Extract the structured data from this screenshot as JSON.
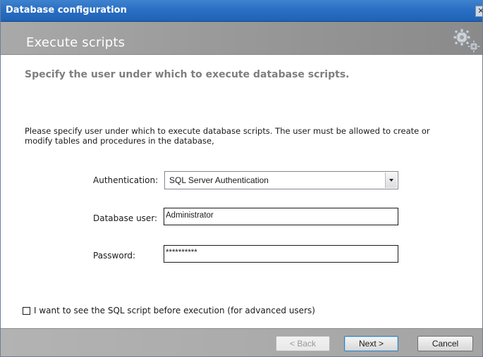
{
  "window": {
    "title": "Database configuration",
    "close_glyph": "✕"
  },
  "header": {
    "title": "Execute scripts",
    "icon": "gears-icon"
  },
  "main": {
    "heading": "Specify the user under which to execute database scripts.",
    "description_line1": "Please specify user under which to execute database scripts. The user must be allowed to create or",
    "description_line2": "modify tables and procedures in the database,"
  },
  "form": {
    "authentication_label": "Authentication:",
    "authentication_value": "SQL Server Authentication",
    "database_user_label": "Database user:",
    "database_user_value": "Administrator",
    "password_label": "Password:",
    "password_value": "**********"
  },
  "options": {
    "show_script_label": "I want to see the SQL script before execution (for advanced users)",
    "show_script_checked": false
  },
  "footer": {
    "back_label": "< Back",
    "next_label": "Next >",
    "cancel_label": "Cancel"
  },
  "colors": {
    "titlebar": "#2a6fc4",
    "header_band": "#9b9b9b",
    "heading_text": "#7e7e7e"
  }
}
